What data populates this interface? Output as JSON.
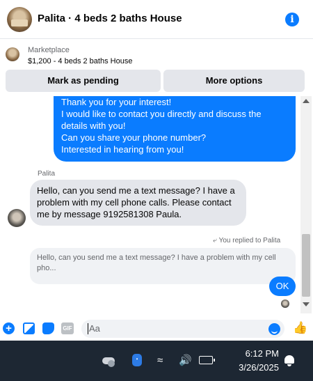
{
  "header": {
    "title": "Palita · 4 beds 2 baths House",
    "info_icon": "info-icon"
  },
  "listing": {
    "source_label": "Marketplace",
    "price_title": "$1,200 - 4 beds 2 baths House"
  },
  "actions": {
    "pending_label": "Mark as pending",
    "more_label": "More options"
  },
  "messages": {
    "outgoing_lines": [
      "Thank you for your interest!",
      "I would like to contact you directly and discuss the",
      "details with you!",
      "Can you share your phone number?",
      "Interested in hearing from you!"
    ],
    "sender_name": "Palita",
    "incoming_lines": [
      "Hello, can you send me a text message? I have a",
      "problem with my cell phone calls. Please contact",
      "me by message 9192581308 Paula."
    ],
    "replied_label": "You replied to Palita",
    "quote_lines": [
      "Hello, can you send me a text message? I have a problem with my cell",
      "pho..."
    ],
    "reply_text": "OK"
  },
  "composer": {
    "placeholder": "Aa",
    "gif_label": "GIF"
  },
  "taskbar": {
    "time": "6:12 PM",
    "date": "3/26/2025"
  },
  "colors": {
    "accent": "#0a7cff",
    "bubble_gray": "#e4e6eb",
    "taskbar_bg": "#1d2733"
  }
}
